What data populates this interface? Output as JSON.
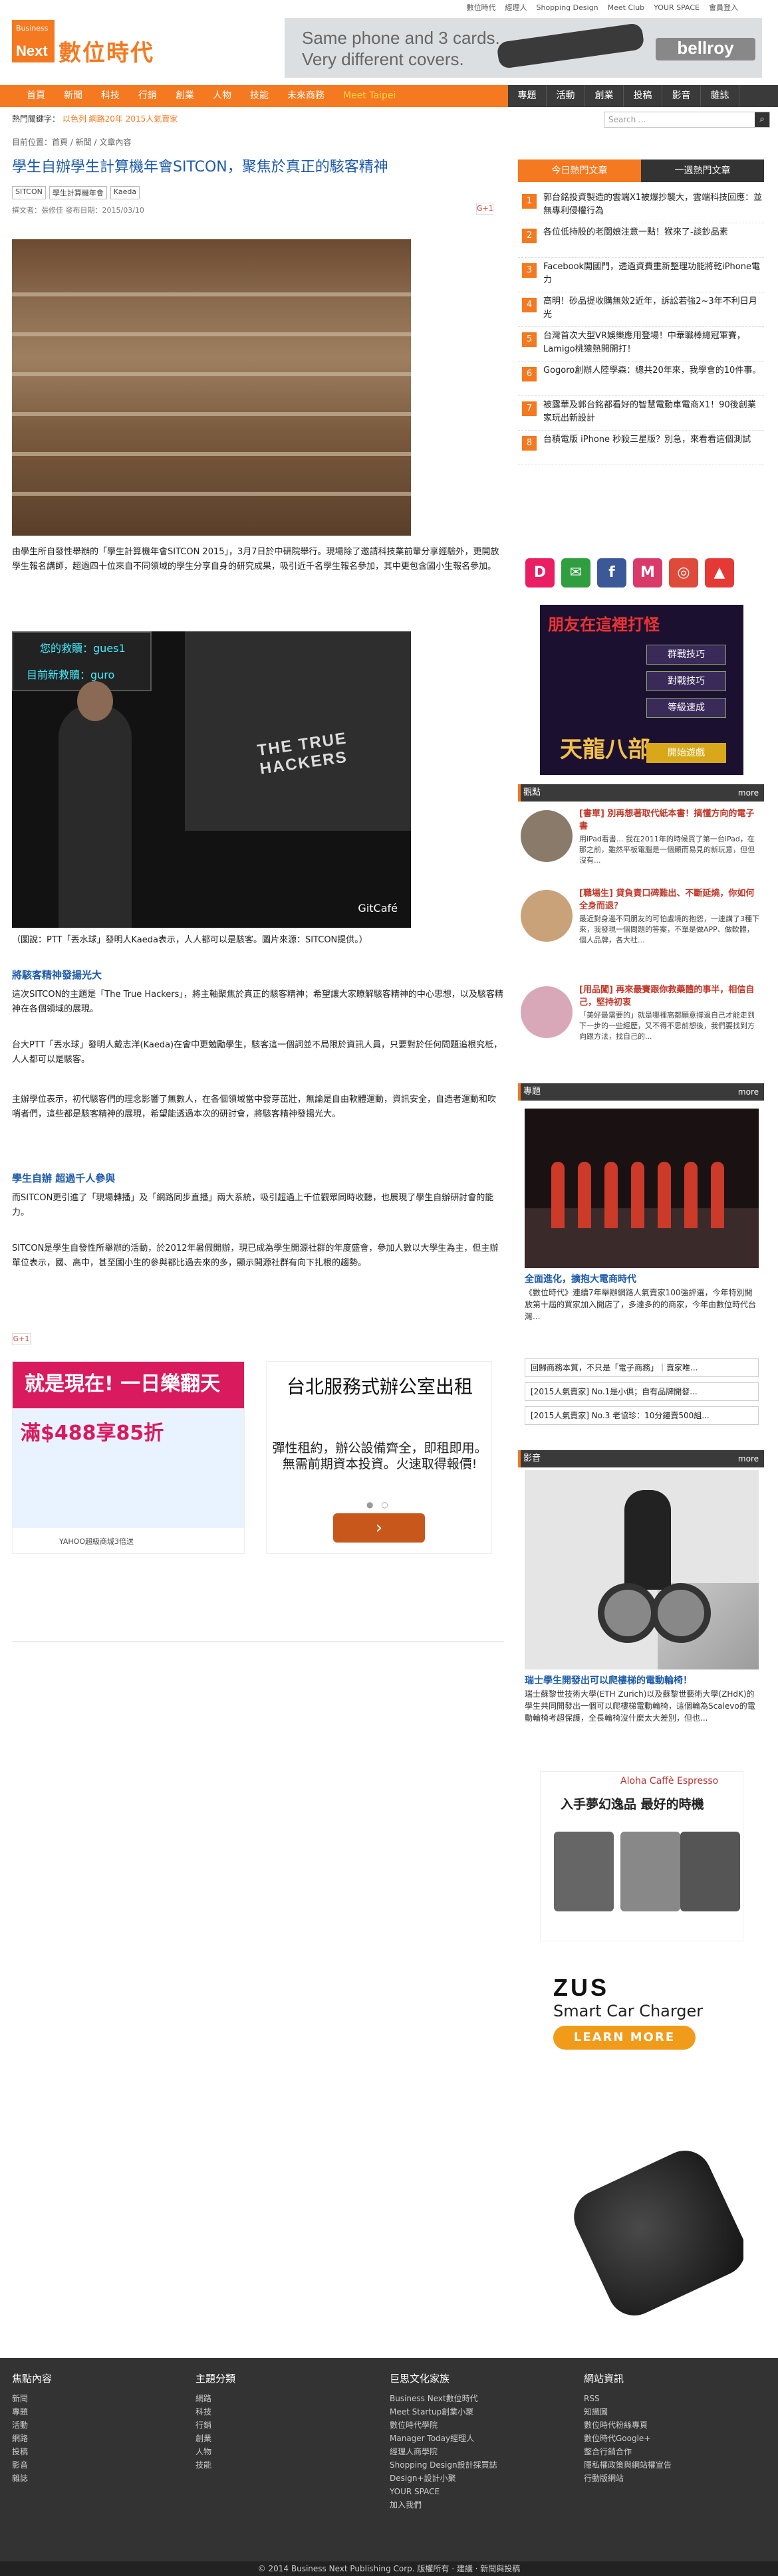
{
  "toplinks": [
    "數位時代",
    "經理人",
    "Shopping Design",
    "Meet Club",
    "YOUR SPACE",
    "會員登入"
  ],
  "logo": {
    "biz": "Business",
    "next": "Next",
    "tw": "數位時代"
  },
  "head_ad": {
    "line1": "Same phone and 3 cards.",
    "line2": "Very different covers.",
    "brand": "bellroy"
  },
  "nav": {
    "left": [
      "首頁",
      "新聞",
      "科技",
      "行銷",
      "創業",
      "人物",
      "技能",
      "未來商務",
      "Meet Taipei"
    ],
    "right": [
      "專題",
      "活動",
      "創業",
      "投稿",
      "影音",
      "雜誌"
    ]
  },
  "hot": {
    "label": "熱門關鍵字：",
    "words": "以色列  網路20年  2015人氣賣家"
  },
  "search": {
    "placeholder": "Search ..."
  },
  "crumb": "目前位置：首頁 / 新聞 / 文章內容",
  "article": {
    "title": "學生自辦學生計算機年會SITCON，聚焦於真正的駭客精神",
    "tags": [
      "SITCON",
      "學生計算機年會",
      "Kaeda"
    ],
    "meta": "撰文者：張修佳   發布日期：2015/03/10",
    "p1": "由學生所自發性舉辦的「學生計算機年會SITCON 2015」，3月7日於中研院舉行。現場除了邀請科技業前輩分享經驗外，更開放學生報名講師，超過四十位來自不同領域的學生分享自身的研究成果，吸引近千名學生報名參加，其中更包含國小生報名參加。",
    "caption": "（圖說：PTT「丟水球」發明人Kaeda表示，人人都可以是駭客。圖片來源：SITCON提供。）",
    "h1": "將駭客精神發揚光大",
    "p2": "這次SITCON的主題是「The True Hackers」，將主軸聚焦於真正的駭客精神；希望讓大家瞭解駭客精神的中心思想，以及駭客精神在各個領域的展現。",
    "p3": "台大PTT「丟水球」發明人戴志洋(Kaeda)在會中更勉勵學生，駭客這一個詞並不局限於資訊人員，只要對於任何問題追根究柢，人人都可以是駭客。",
    "p4": "主辦學位表示，初代駭客們的理念影響了無數人，在各個領域當中發芽茁壯，無論是自由軟體運動，資訊安全，自造者運動和吹哨者們，這些都是駭客精神的展現，希望能透過本次的研討會，將駭客精神發揚光大。",
    "h2": "學生自辦 超過千人參與",
    "p5": "而SITCON更引進了「現場轉播」及「網路同步直播」兩大系統，吸引超過上千位觀眾同時收聽，也展現了學生自辦研討會的能力。",
    "p6": "SITCON是學生自發性所舉辦的活動，於2012年暑假開辦，現已成為學生開源社群的年度盛會，參加人數以大學生為主，但主辦單位表示，國、高中，甚至國小生的參與都比過去來的多，顯示開源社群有向下扎根的趨勢。"
  },
  "photo1_text": {
    "board1": "您的救贖：gues1",
    "board2": "目前新救贖：guro"
  },
  "photo2_text": {
    "hackers": "THE TRUE HACKERS",
    "gitcafe": "GitCafé"
  },
  "ad1": {
    "top": "就是現在! 一日樂翻天",
    "mid": "滿$488享85折",
    "foot": "YAHOO超級商城3倍送"
  },
  "ad2": {
    "title": "台北服務式辦公室出租",
    "sub": "彈性租約，辦公設備齊全，即租即用。無需前期資本投資。火速取得報價!",
    "btn": "›"
  },
  "sidebar": {
    "tabs": [
      "今日熱門文章",
      "一週熱門文章"
    ],
    "hot": [
      "郭台銘投資製造的雲端X1被爆抄襲大，雲端科技回應：並無專利侵權行為",
      "各位低持股的老闆娘注意一點！猴來了-談鈔品素",
      "Facebook開國門，透過資費重新整理功能將乾iPhone電力",
      "高明！砂品提收購無效2近年，訴訟若強2~3年不利日月光",
      "台灣首次大型VR娛樂應用登場！中華職棒總冠軍賽，Lamigo桃猿熱開開打！",
      "Gogoro創辦人陸學森：總共20年來，我學會的10件事。",
      "被露華及郭台銘都看好的智慧電動車電商X1！90後創業家玩出新設計",
      "台積電版 iPhone 秒殺三星版？別急，來看看這個測試"
    ],
    "socials": [
      "D",
      "✉",
      "f",
      "M",
      "◎",
      "▲"
    ],
    "game": {
      "title": "朋友在這裡打怪",
      "opts": [
        "群戰技巧",
        "對戰技巧",
        "等級速成"
      ],
      "gold": "天龍八部",
      "go": "開始遊戲"
    },
    "opinion": {
      "label": "觀點",
      "more": "more",
      "items": [
        {
          "title": "[書單] 別再想著取代紙本書！搞懂方向的電子書",
          "desc": "用iPad看書... 我在2011年的時候買了第一台iPad，在那之前，雖然平板電腦是一個顯而易見的新玩意，但但沒有..."
        },
        {
          "title": "[職場生] 貸負責口碑難出、不斷延燒，你如何全身而退？",
          "desc": "最近對身邊不同朋友的可怕處境的抱怨，一連講了3種下來，我發現一個問題的答案，不單是做APP、做軟體，個人品牌，各大社..."
        },
        {
          "title": "[用品闖] 再來最賽跟你救藥體的事半，相信自己，堅持初衷",
          "desc": "「美好最需要的」就是哪裡高都願意撐過自己才能走到下一步的一些經歷，又不得不思前想後，我們要找到方向跟方法，找自己的..."
        }
      ]
    },
    "topic": {
      "label": "專題",
      "more": "more",
      "title": "全面進化，擴抱大電商時代",
      "desc": "《數位時代》連續7年舉辦網路人氣賣家100強評選，今年特別開放第十屆的買家加入開店了，多達多的的商家，今年由數位時代台灣...",
      "links": [
        "回歸商務本質，不只是「電子商務」｜賣家唯...",
        "[2015人氣賣家] No.1是小俱；自有品牌開發...",
        "[2015人氣賣家] No.3 老協珍：10分鐘賣500組..."
      ]
    },
    "video": {
      "label": "影音",
      "more": "more",
      "title": "瑞士學生開發出可以爬樓梯的電動輪椅！",
      "desc": "瑞士蘇黎世技術大學(ETH Zurich)以及蘇黎世藝術大學(ZHdK)的學生共同開發出一個可以爬樓梯電動輪椅，這個輪為Scalevo的電動輪椅考超保護，全長輪椅沒什麼太大差別，但也..."
    },
    "coffee": {
      "brand": "Aloha Caffè  Espresso",
      "line": "入手夢幻逸品 最好的時機"
    },
    "zus": {
      "logo": "ZUS",
      "sub": "Smart Car Charger",
      "btn": "LEARN MORE"
    }
  },
  "footer": {
    "c1": {
      "h": "焦點內容",
      "items": [
        "新聞",
        "專題",
        "活動",
        "網路",
        "投稿",
        "影音",
        "雜誌"
      ]
    },
    "c2": {
      "h": "主題分類",
      "items": [
        "網路",
        "科技",
        "行銷",
        "創業",
        "人物",
        "技能"
      ]
    },
    "c3": {
      "h": "巨思文化家族",
      "items": [
        "Business Next數位時代",
        "Meet Startup創業小聚",
        "數位時代學院",
        "Manager Today經理人",
        "經理人商學院",
        "Shopping Design設計採買誌",
        "Design+設計小聚",
        "YOUR SPACE",
        "加入我們"
      ]
    },
    "c4": {
      "h": "網站資訊",
      "items": [
        "RSS",
        "知識圖",
        "數位時代粉絲專頁",
        "數位時代Google+",
        "整合行銷合作",
        "隱私權政策與網站權宣告",
        "行動版網站"
      ]
    },
    "copy": "© 2014 Business Next Publishing Corp. 版權所有 · 建議 · 新聞與投稿"
  }
}
